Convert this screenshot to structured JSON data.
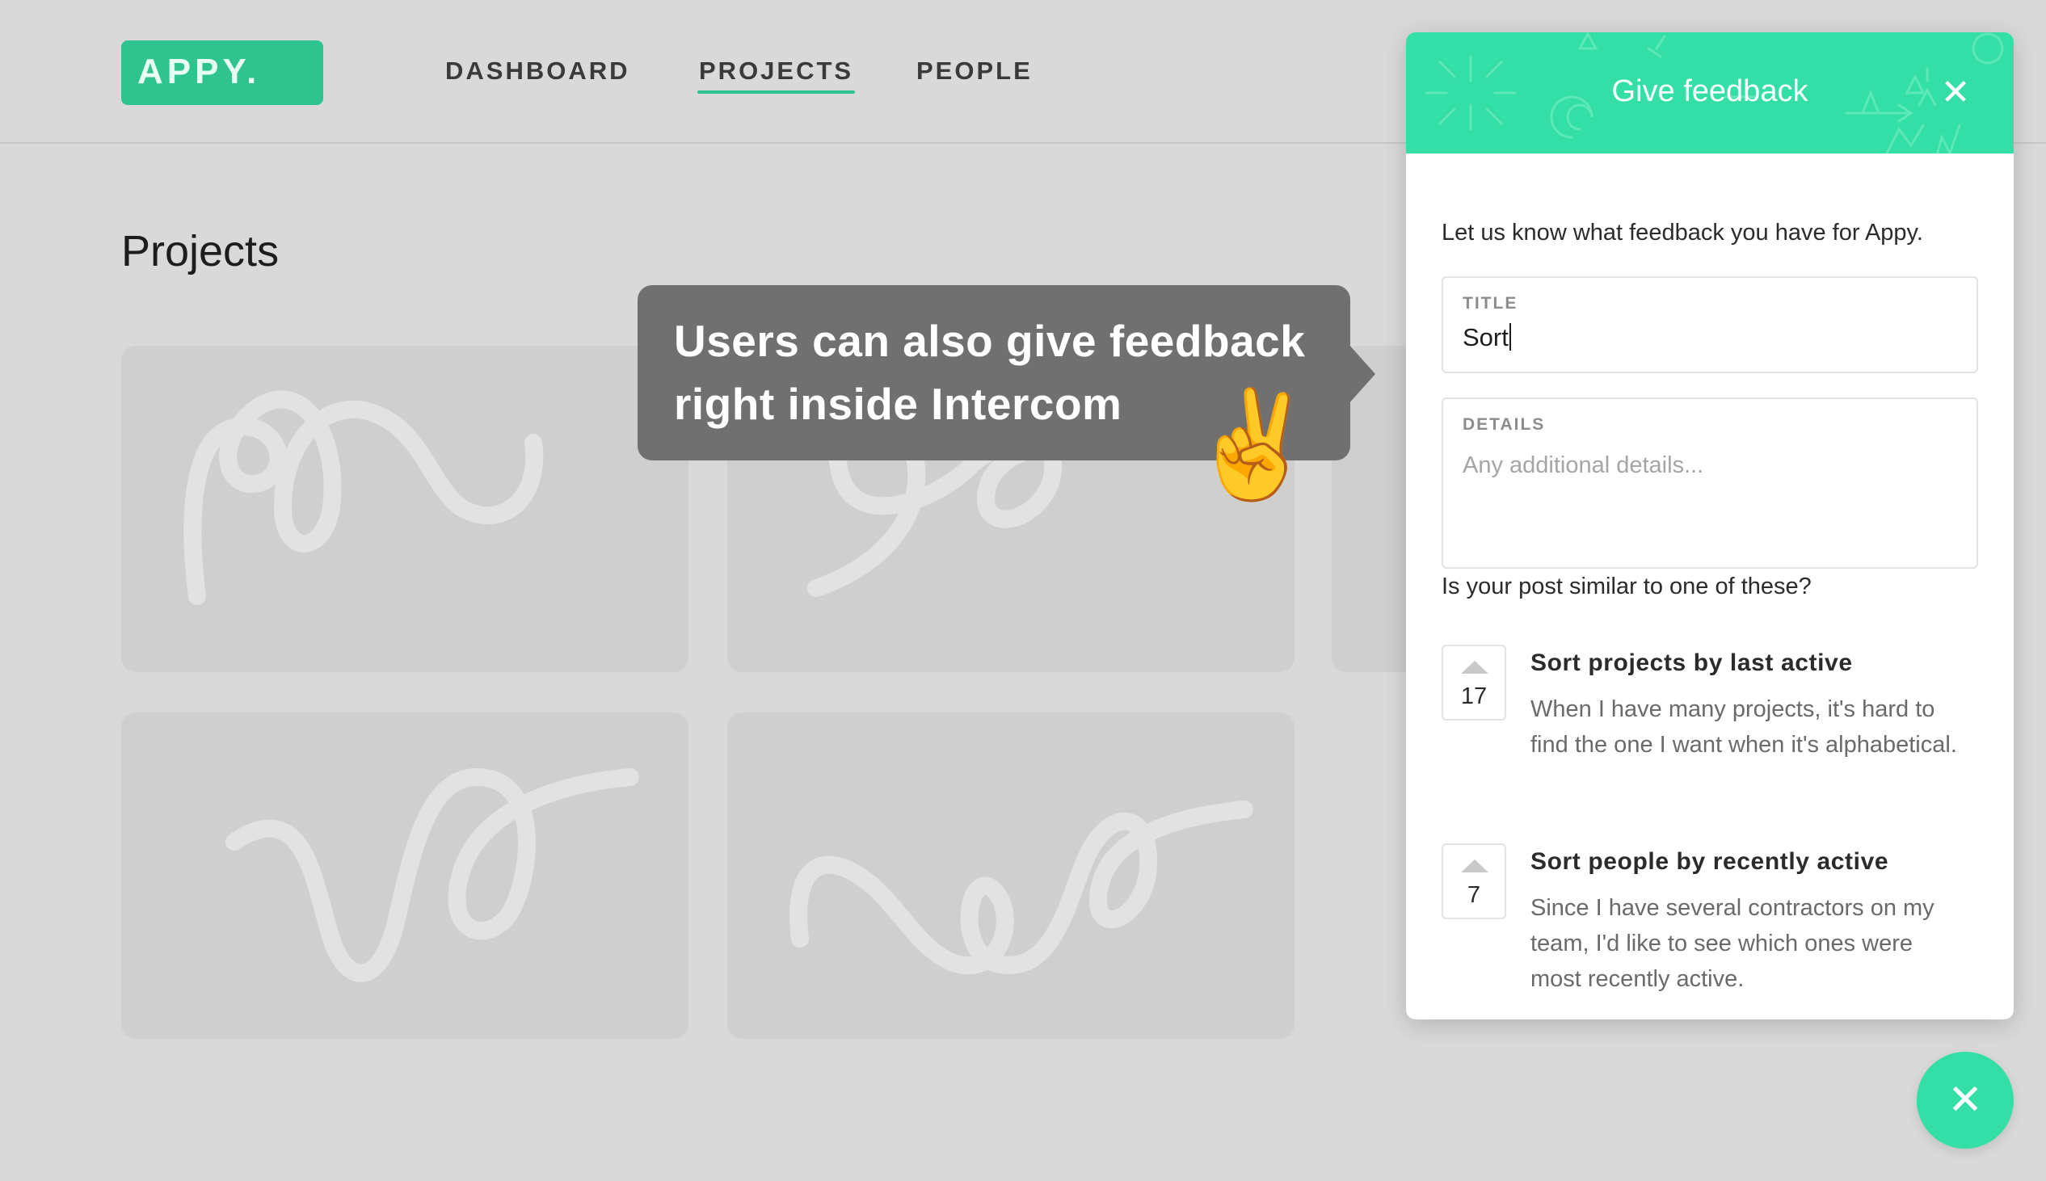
{
  "header": {
    "logo_text": "APPY.",
    "nav": [
      {
        "label": "DASHBOARD",
        "active": false
      },
      {
        "label": "PROJECTS",
        "active": true
      },
      {
        "label": "PEOPLE",
        "active": false
      }
    ]
  },
  "main": {
    "title": "Projects"
  },
  "tooltip": {
    "line1": "Users can also give feedback",
    "line2": "right inside Intercom",
    "emoji": "✌️"
  },
  "feedback_panel": {
    "title": "Give feedback",
    "close_icon": "close-icon",
    "intro": "Let us know what feedback you have for Appy.",
    "title_field": {
      "label": "TITLE",
      "value": "Sort"
    },
    "details_field": {
      "label": "DETAILS",
      "placeholder": "Any additional details..."
    },
    "similar_question": "Is your post similar to one of these?",
    "suggestions": [
      {
        "votes": "17",
        "title": "Sort projects by last active",
        "description": "When I have many projects, it's hard to find the one I want when it's alphabetical."
      },
      {
        "votes": "7",
        "title": "Sort people by recently active",
        "description": "Since I have several contractors on my team, I'd like to see which ones were most recently active."
      }
    ]
  },
  "launcher": {
    "icon": "close-icon"
  },
  "colors": {
    "brand_green": "#2fc48f",
    "panel_accent": "#33dfa7",
    "tooltip_bg": "#707070",
    "page_bg": "#d9d9d9"
  }
}
